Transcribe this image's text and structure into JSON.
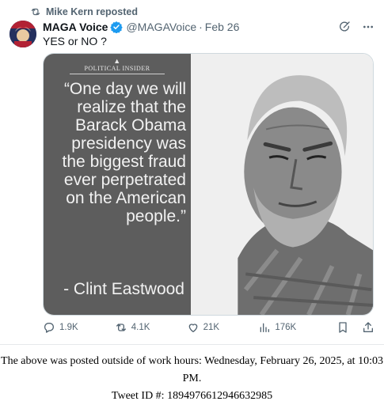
{
  "repost": {
    "text": "Mike Kern reposted"
  },
  "tweet": {
    "display_name": "MAGA Voice",
    "handle": "@MAGAVoice",
    "separator": "·",
    "date": "Feb 26",
    "text": "YES or NO ?"
  },
  "media": {
    "logo": "POLITICAL INSIDER",
    "quote": "“One day we will realize that the Barack Obama presidency was the biggest fraud ever perpetrated on the American people.”",
    "attribution": "- Clint Eastwood"
  },
  "stats": {
    "replies": "1.9K",
    "reposts": "4.1K",
    "likes": "21K",
    "views": "176K"
  },
  "footer": {
    "line1": "The above was posted outside of work hours: Wednesday, February 26, 2025, at 10:03 PM.",
    "line2": "Tweet ID #: 1894976612946632985"
  },
  "colors": {
    "verified": "#1d9bf0",
    "muted": "#536471",
    "quote_bg": "#5d5d5d"
  }
}
